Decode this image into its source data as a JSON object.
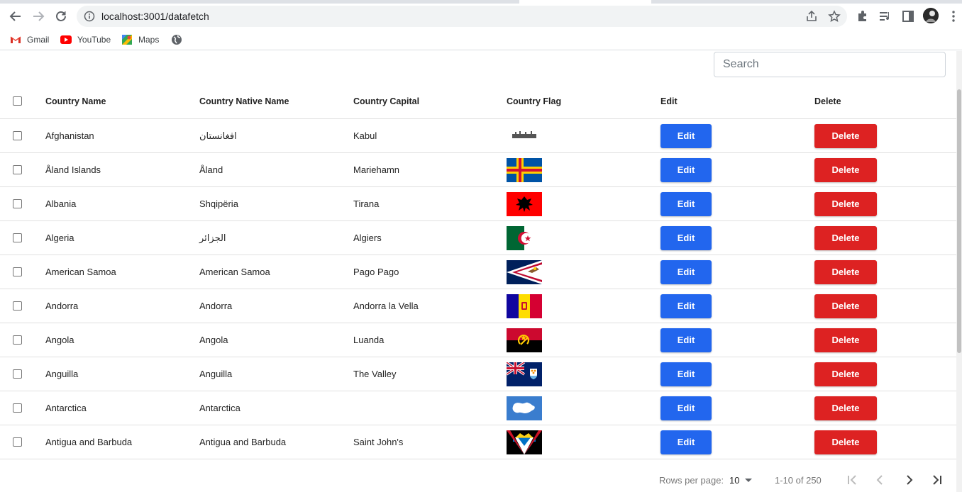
{
  "browser": {
    "url": "localhost:3001/datafetch",
    "bookmarks": [
      {
        "label": "Gmail",
        "icon": "gmail-icon"
      },
      {
        "label": "YouTube",
        "icon": "youtube-icon"
      },
      {
        "label": "Maps",
        "icon": "maps-icon"
      }
    ]
  },
  "search": {
    "placeholder": "Search"
  },
  "table": {
    "headers": {
      "name": "Country Name",
      "native": "Country Native Name",
      "capital": "Country Capital",
      "flag": "Country Flag",
      "edit": "Edit",
      "delete": "Delete"
    },
    "edit_label": "Edit",
    "delete_label": "Delete",
    "rows": [
      {
        "name": "Afghanistan",
        "native": "افغانستان",
        "capital": "Kabul",
        "flag": "af"
      },
      {
        "name": "Åland Islands",
        "native": "Åland",
        "capital": "Mariehamn",
        "flag": "ax"
      },
      {
        "name": "Albania",
        "native": "Shqipëria",
        "capital": "Tirana",
        "flag": "al"
      },
      {
        "name": "Algeria",
        "native": "الجزائر",
        "capital": "Algiers",
        "flag": "dz"
      },
      {
        "name": "American Samoa",
        "native": "American Samoa",
        "capital": "Pago Pago",
        "flag": "as"
      },
      {
        "name": "Andorra",
        "native": "Andorra",
        "capital": "Andorra la Vella",
        "flag": "ad"
      },
      {
        "name": "Angola",
        "native": "Angola",
        "capital": "Luanda",
        "flag": "ao"
      },
      {
        "name": "Anguilla",
        "native": "Anguilla",
        "capital": "The Valley",
        "flag": "ai"
      },
      {
        "name": "Antarctica",
        "native": "Antarctica",
        "capital": "",
        "flag": "aq"
      },
      {
        "name": "Antigua and Barbuda",
        "native": "Antigua and Barbuda",
        "capital": "Saint John's",
        "flag": "ag"
      }
    ]
  },
  "pagination": {
    "rows_per_page_label": "Rows per page:",
    "rows_per_page": "10",
    "range": "1-10 of 250"
  },
  "colors": {
    "edit": "#2266ee",
    "delete": "#dd2222"
  }
}
